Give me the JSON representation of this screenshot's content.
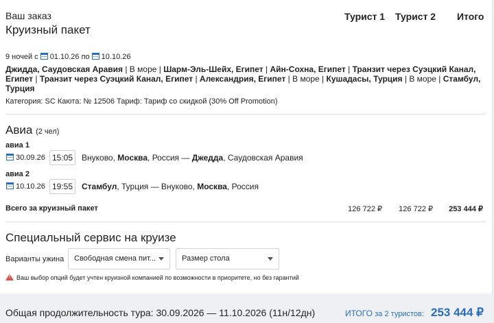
{
  "header": {
    "order_label": "Ваш заказ",
    "package_title": "Круизный пакет",
    "col_tourist1": "Турист 1",
    "col_tourist2": "Турист 2",
    "col_total": "Итого"
  },
  "cruise": {
    "nights": "9 ночей с",
    "date_from": "01.10.26",
    "to_word": "по",
    "date_to": "10.10.26",
    "route_line1": [
      {
        "t": "Джидда, Саудовская Аравия",
        "b": true
      },
      {
        "t": " | В море | ",
        "b": false
      },
      {
        "t": "Шарм-Эль-Шейх, Египет",
        "b": true
      },
      {
        "t": " | ",
        "b": false
      },
      {
        "t": "Айн-Сохна, Египет",
        "b": true
      },
      {
        "t": " | ",
        "b": false
      },
      {
        "t": "Транзит через Суэцкий Канал,",
        "b": true
      }
    ],
    "route_line2": [
      {
        "t": "Египет",
        "b": true
      },
      {
        "t": " | ",
        "b": false
      },
      {
        "t": "Транзит через Суэцкий Канал, Египет",
        "b": true
      },
      {
        "t": " | ",
        "b": false
      },
      {
        "t": "Александрия, Египет",
        "b": true
      },
      {
        "t": " | В море | ",
        "b": false
      },
      {
        "t": "Кушадасы, Турция",
        "b": true
      },
      {
        "t": " | В море | ",
        "b": false
      },
      {
        "t": "Стамбул,",
        "b": true
      }
    ],
    "route_line3": [
      {
        "t": "Турция",
        "b": true
      }
    ],
    "details": "Категория: SC   Каюта: № 12506   Тариф: Тариф со скидкой (30% Off Promotion)"
  },
  "avia": {
    "title": "Авиа",
    "people": "(2 чел)",
    "flights": [
      {
        "label": "авиа 1",
        "date": "30.09.26",
        "time": "15:05",
        "route": [
          {
            "t": "Внуково, ",
            "b": false
          },
          {
            "t": "Москва",
            "b": true
          },
          {
            "t": ", Россия — ",
            "b": false
          },
          {
            "t": "Джедда",
            "b": true
          },
          {
            "t": ", Саудовская Аравия",
            "b": false
          }
        ]
      },
      {
        "label": "авиа 2",
        "date": "10.10.26",
        "time": "19:55",
        "route": [
          {
            "t": "Стамбул",
            "b": true
          },
          {
            "t": ", Турция — Внуково, ",
            "b": false
          },
          {
            "t": "Москва",
            "b": true
          },
          {
            "t": ", Россия",
            "b": false
          }
        ]
      }
    ],
    "total_label": "Всего за круизный пакет",
    "total_t1": "126 722 ₽",
    "total_t2": "126 722 ₽",
    "total_all": "253 444 ₽"
  },
  "special": {
    "title": "Специальный сервис на круизе",
    "dinner_label": "Варианты ужина",
    "dinner_value": "Свободная смена пит...",
    "table_value": "Размер стола",
    "warning": "Ваш выбор опций будет учтен круизной компанией по возможности в приоритете, но без гарантий"
  },
  "footer": {
    "duration": "Общая продолжительность тура: 30.09.2026 — 11.10.2026 (11н/12дн)",
    "total_label": "ИТОГО",
    "total_for": "за 2 туристов:",
    "total_value": "253 444 ₽"
  },
  "colors": {
    "accent": "#2a6ebb",
    "warning": "#d9534f"
  }
}
